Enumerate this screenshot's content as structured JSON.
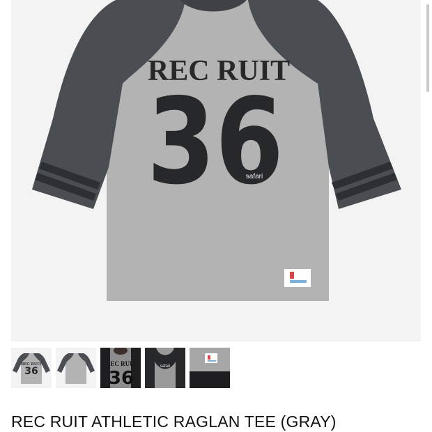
{
  "product": {
    "title": "REC RUIT ATHLETIC RAGLAN TEE (GRAY)",
    "image": {
      "print_line1": "REC RUIT",
      "print_number": "36",
      "brand_mark": "safari",
      "tag_label": "ecsf"
    }
  },
  "thumbnails": [
    {
      "label": "front view",
      "print": "REC RUIT",
      "number": "36"
    },
    {
      "label": "back view"
    },
    {
      "label": "model view",
      "print": "EC RUI",
      "number": "36"
    },
    {
      "label": "detail neck label",
      "print": "safari"
    },
    {
      "label": "detail hem tag"
    }
  ],
  "colors": {
    "body_gray": "#b3b3b3",
    "sleeve_charcoal": "#4a4d52",
    "print_black": "#26282a",
    "background": "#f3f3f3"
  }
}
